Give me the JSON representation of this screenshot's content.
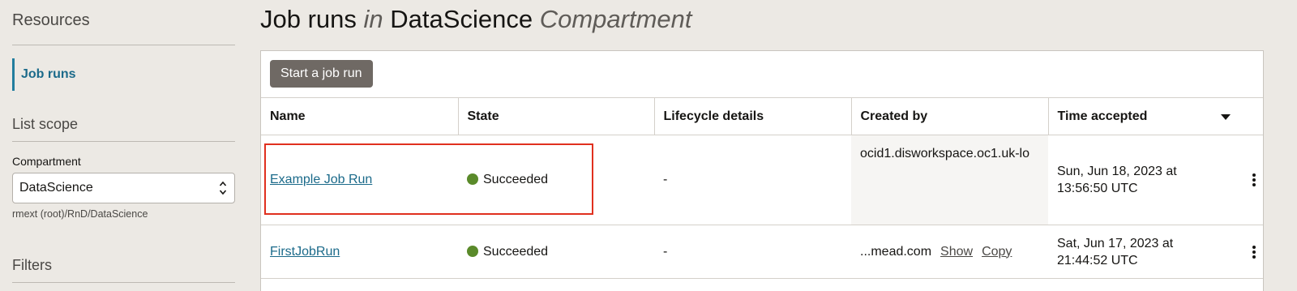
{
  "sidebar": {
    "resources_heading": "Resources",
    "nav_items": [
      {
        "label": "Job runs"
      }
    ],
    "list_scope_heading": "List scope",
    "compartment_label": "Compartment",
    "compartment_value": "DataScience",
    "compartment_path": "rmext (root)/RnD/DataScience",
    "filters_heading": "Filters"
  },
  "header": {
    "title_main": "Job runs",
    "title_in": "in",
    "title_compartment_name": "DataScience",
    "title_compartment_word": "Compartment"
  },
  "toolbar": {
    "start_label": "Start a job run"
  },
  "table": {
    "columns": [
      "Name",
      "State",
      "Lifecycle details",
      "Created by",
      "Time accepted"
    ],
    "rows": [
      {
        "name": "Example Job Run",
        "state": "Succeeded",
        "lifecycle": "-",
        "created_by": "ocid1.disworkspace.oc1.uk-lo",
        "time": "Sun, Jun 18, 2023 at 13:56:50 UTC"
      },
      {
        "name": "FirstJobRun",
        "state": "Succeeded",
        "lifecycle": "-",
        "created_by": "...mead.com",
        "created_show": "Show",
        "created_copy": "Copy",
        "time": "Sat, Jun 17, 2023 at 21:44:52 UTC"
      }
    ]
  },
  "colors": {
    "state_succeeded": "#5a8a2a",
    "accent": "#1b6a8a",
    "highlight": "#e0301e"
  },
  "icons": [
    "chevron-updown-icon",
    "sort-caret-icon",
    "kebab-menu-icon",
    "status-dot-icon"
  ]
}
